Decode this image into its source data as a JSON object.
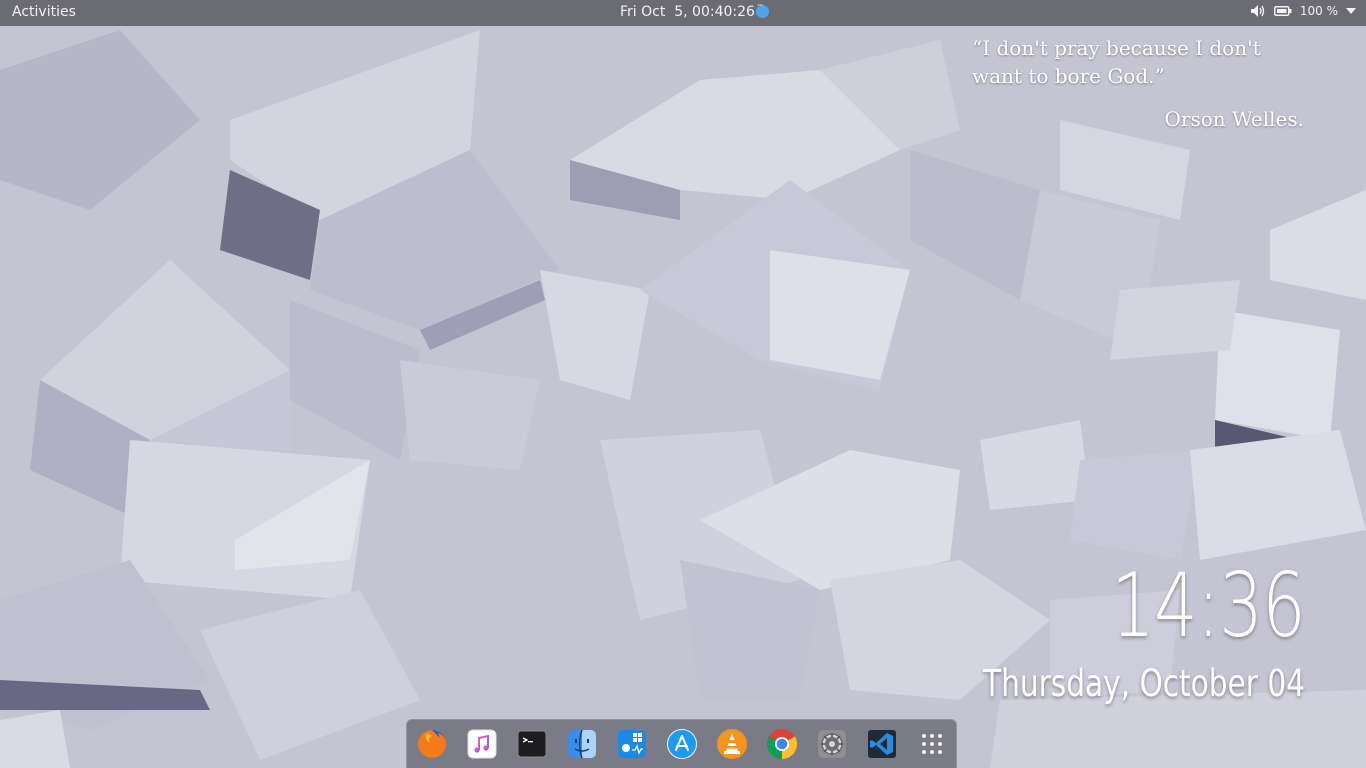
{
  "topbar": {
    "activities_label": "Activities",
    "datetime": "Fri Oct  5, 00:40:26",
    "notification_icon": "chat-bubble-icon",
    "volume_icon": "speaker-icon",
    "battery_icon": "battery-icon",
    "battery_percent": "100 %",
    "menu_icon": "caret-down-icon"
  },
  "quote": {
    "text": "“I don't pray because I don't want to bore God.”",
    "author": "Orson Welles."
  },
  "desktop_clock": {
    "time": "14:36",
    "date": "Thursday, October 04"
  },
  "dock": {
    "apps": [
      {
        "name": "Firefox",
        "icon": "firefox-icon"
      },
      {
        "name": "iTunes",
        "icon": "music-note-icon"
      },
      {
        "name": "Terminal",
        "icon": "terminal-icon"
      },
      {
        "name": "Finder",
        "icon": "finder-icon"
      },
      {
        "name": "Boot Camp",
        "icon": "bootcamp-icon"
      },
      {
        "name": "App Store",
        "icon": "app-store-icon"
      },
      {
        "name": "VLC",
        "icon": "vlc-cone-icon"
      },
      {
        "name": "Chrome",
        "icon": "chrome-icon"
      },
      {
        "name": "System Preferences",
        "icon": "gear-icon"
      },
      {
        "name": "Visual Studio Code",
        "icon": "vscode-icon"
      },
      {
        "name": "Show Applications",
        "icon": "app-grid-icon"
      }
    ]
  },
  "colors": {
    "topbar_bg": "#222226",
    "dock_bg": "#4e4e58",
    "wallpaper_base": "#c9c9d6"
  }
}
